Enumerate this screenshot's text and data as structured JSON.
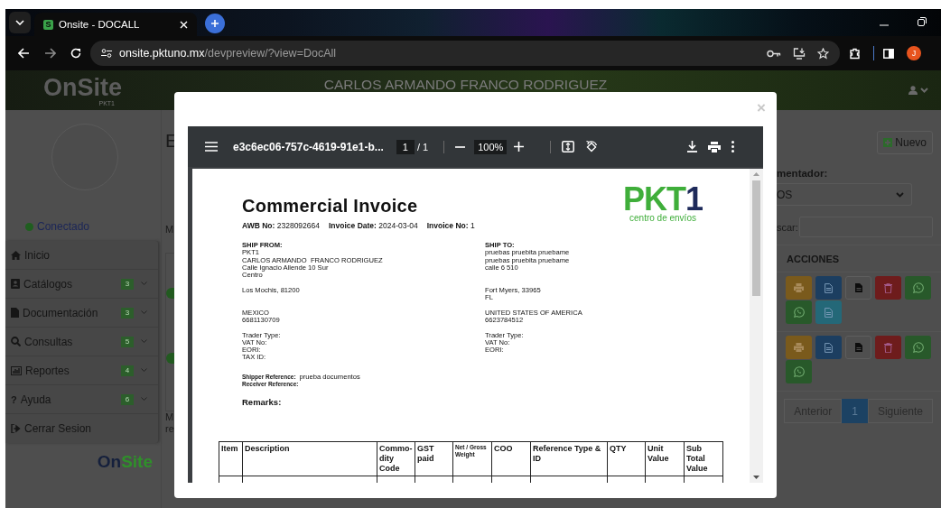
{
  "browser": {
    "tab": {
      "title": "Onsite - DOCALL",
      "favicon": "S",
      "selected": true
    },
    "url": {
      "host": "onsite.pktuno.mx",
      "path": "/devpreview/?view=DocAll"
    },
    "profile_initial": "J"
  },
  "header": {
    "logo": "OnSite",
    "logo_sub": "PKT1",
    "user_name": "CARLOS ARMANDO FRANCO RODRIGUEZ"
  },
  "sidebar": {
    "status": "Conectado",
    "online": true,
    "items": [
      {
        "label": "Inicio"
      },
      {
        "label": "Catálogos",
        "badge": "3"
      },
      {
        "label": "Documentación",
        "badge": "3"
      },
      {
        "label": "Consultas",
        "badge": "5"
      },
      {
        "label": "Reportes",
        "badge": "4"
      },
      {
        "label": "Ayuda",
        "badge": "6",
        "glyph": "?"
      },
      {
        "label": "Cerrar Sesion"
      }
    ],
    "footer_logo": [
      "On",
      "Site"
    ]
  },
  "main": {
    "heading": "E",
    "label": "M",
    "footer_lines": [
      "M",
      "re"
    ]
  },
  "right_panel": {
    "new_button": "Nuevo",
    "filter_label": "mentador:",
    "filter_value": "OS",
    "search_label": "scar:",
    "actions_header": "ACCIONES",
    "rows": [
      {
        "actions": [
          {
            "kind": "print"
          },
          {
            "kind": "document"
          },
          {
            "kind": "file"
          },
          {
            "kind": "delete"
          },
          {
            "kind": "whatsapp"
          },
          {
            "kind": "whatsapp"
          },
          {
            "kind": "note"
          }
        ]
      },
      {
        "actions": [
          {
            "kind": "print"
          },
          {
            "kind": "document"
          },
          {
            "kind": "file"
          },
          {
            "kind": "delete"
          },
          {
            "kind": "whatsapp"
          },
          {
            "kind": "whatsapp"
          }
        ]
      }
    ],
    "pagination": {
      "prev": "Anterior",
      "pages": [
        {
          "label": "1",
          "selected": true
        }
      ],
      "next": "Siguiente"
    }
  },
  "modal": {
    "close": "×",
    "viewer": {
      "filename": "e3c6ec06-757c-4619-91e1-b...",
      "page": "1",
      "page_count": "/ 1",
      "zoom": "100%"
    },
    "document": {
      "title": "Commercial Invoice",
      "meta": [
        {
          "label": "AWB No:",
          "value": "2328092664"
        },
        {
          "label": "Invoice Date:",
          "value": "2024-03-04"
        },
        {
          "label": "Invoice No:",
          "value": "1"
        }
      ],
      "logo": {
        "parts": [
          "PKT",
          "1"
        ],
        "tagline": "centro de envíos"
      },
      "ship": {
        "from_label": "SHIP FROM:",
        "to_label": "SHIP TO:",
        "rows": [
          {
            "from": [
              "PKT1",
              "CARLOS ARMANDO  FRANCO RODRIGUEZ",
              "Calle Ignacio Allende 10 Sur",
              "Centro"
            ],
            "to": [
              "pruebas pruebita pruebame",
              "pruebas pruebita pruebame",
              "calle 6 510"
            ]
          },
          {
            "from": [
              "Los Mochis, 81200"
            ],
            "to": [
              "Fort Myers, 33965",
              "FL"
            ]
          },
          {
            "from": [
              "MEXICO",
              "6681130709"
            ],
            "to": [
              "UNITED STATES OF AMERICA",
              "6623784512"
            ]
          },
          {
            "from": [
              "Trader Type:",
              "VAT No:",
              "EORI:",
              "TAX ID:"
            ],
            "to": [
              "Trader Type:",
              "VAT No:",
              "EORI:"
            ]
          }
        ]
      },
      "references": [
        {
          "label": "Shipper Reference:",
          "value": "prueba documentos"
        },
        {
          "label": "Receiver Reference:"
        }
      ],
      "remarks_label": "Remarks:",
      "table": {
        "columns": [
          {
            "label": "Item",
            "small": false
          },
          {
            "label": "Description",
            "small": false
          },
          {
            "label": "Commo-dity Code",
            "small": false
          },
          {
            "label": "GST paid",
            "small": false
          },
          {
            "label": "Net / Gross Weight",
            "small": true
          },
          {
            "label": "COO",
            "small": false
          },
          {
            "label": "Reference Type & ID",
            "small": false
          },
          {
            "label": "QTY",
            "small": false
          },
          {
            "label": "Unit Value",
            "small": false
          },
          {
            "label": "Sub Total Value",
            "small": false
          }
        ]
      }
    }
  }
}
